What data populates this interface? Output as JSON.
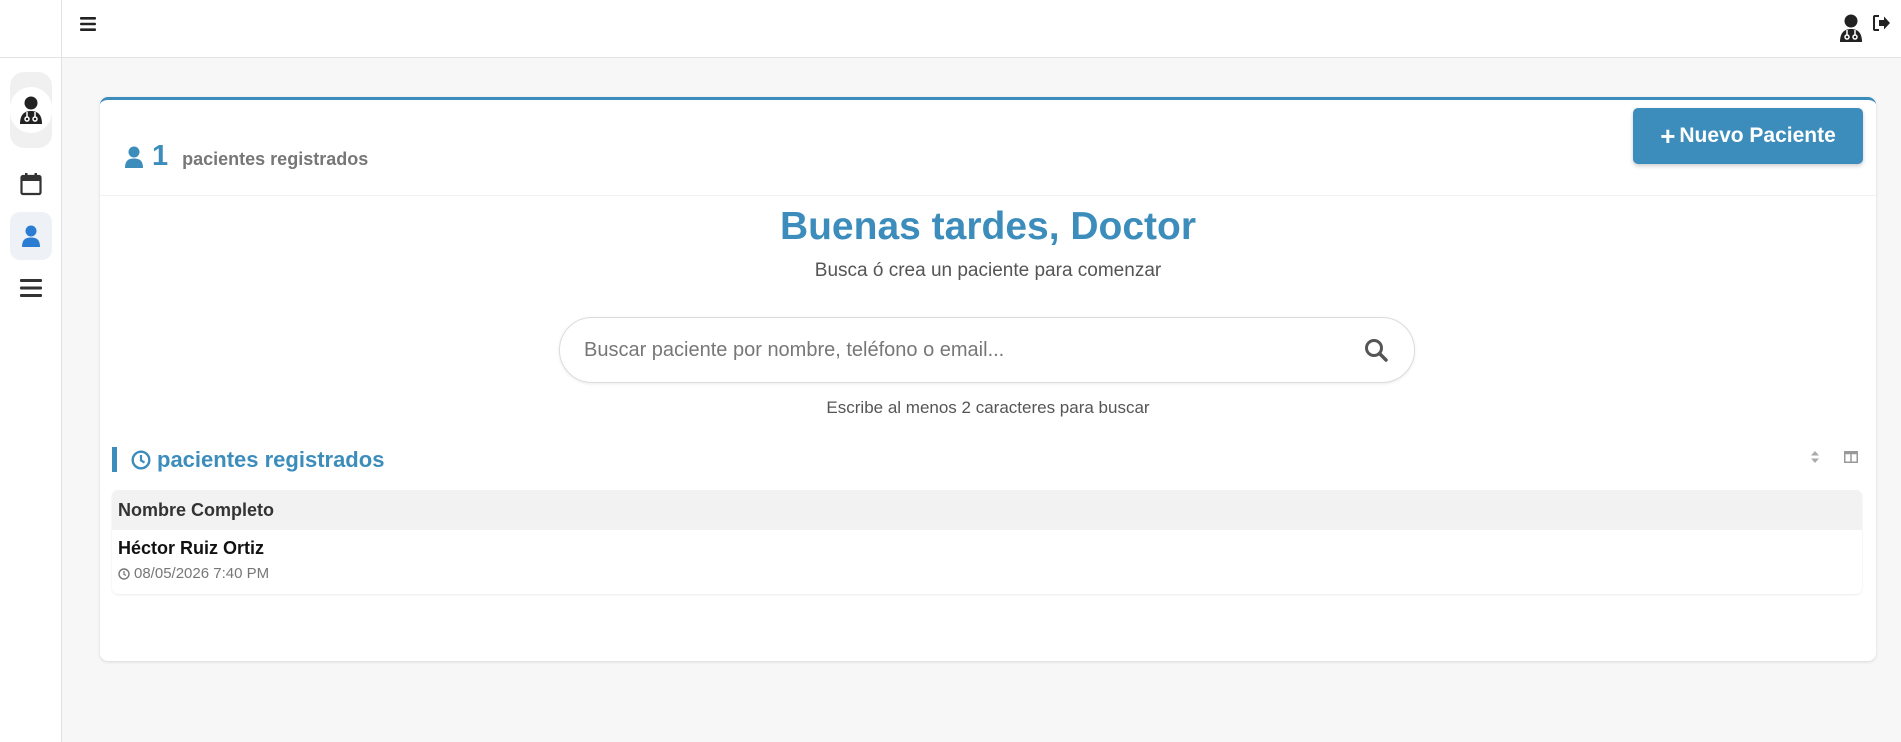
{
  "sidebar": {
    "items": [
      {
        "icon": "doctor-avatar-icon"
      },
      {
        "icon": "calendar-icon"
      },
      {
        "icon": "user-icon",
        "active": true
      },
      {
        "icon": "list-icon"
      }
    ]
  },
  "topbar": {
    "menu_icon": "hamburger-icon",
    "user_icon": "doctor-icon",
    "logout_icon": "logout-icon"
  },
  "stats": {
    "count": "1",
    "label": "pacientes registrados"
  },
  "actions": {
    "new_patient_plus": "+",
    "new_patient_label": "Nuevo Paciente"
  },
  "greeting": {
    "title": "Buenas tardes, Doctor",
    "subtitle": "Busca ó crea un paciente para comenzar"
  },
  "search": {
    "placeholder": "Buscar paciente por nombre, teléfono o email...",
    "hint": "Escribe al menos 2 caracteres para buscar"
  },
  "section": {
    "title": "pacientes registrados"
  },
  "table": {
    "columns": [
      "Nombre Completo"
    ],
    "rows": [
      {
        "name": "Héctor Ruiz Ortiz",
        "date": "08/05/2026 7:40 PM"
      }
    ]
  },
  "colors": {
    "accent": "#3c8dbc",
    "sidebar_active": "#eef1f5",
    "active_icon": "#2b7cd3"
  }
}
